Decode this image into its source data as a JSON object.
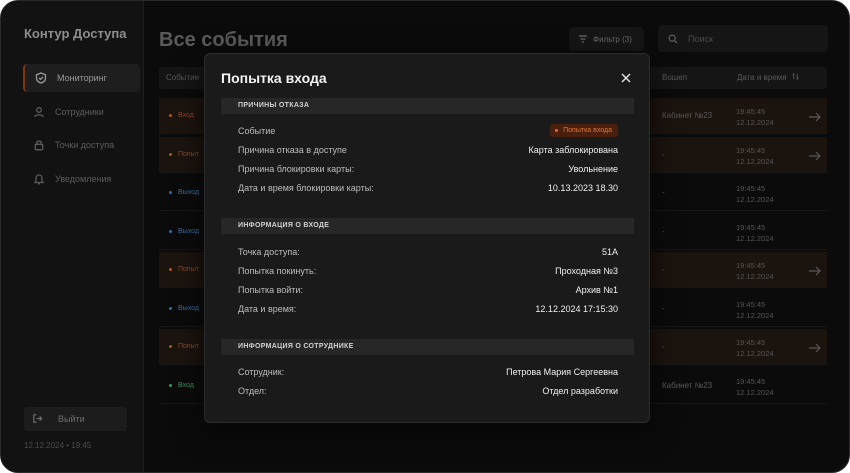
{
  "app": {
    "brand": "Контур Доступа",
    "datetime": "12.12.2024 • 19:45"
  },
  "sidebar": {
    "items": [
      {
        "label": "Мониторинг",
        "icon": "shield-icon",
        "active": true
      },
      {
        "label": "Сотрудники",
        "icon": "users-icon",
        "active": false
      },
      {
        "label": "Точки доступа",
        "icon": "lock-icon",
        "active": false
      },
      {
        "label": "Уведомления",
        "icon": "bell-icon",
        "active": false
      }
    ],
    "logout_label": "Выйти"
  },
  "main": {
    "title": "Все события",
    "filter_label": "Фильтр (3)",
    "search_placeholder": "Поиск",
    "columns": {
      "event": "Событие",
      "entered": "Вошел",
      "datetime": "Дата и время"
    },
    "rows": [
      {
        "event": "Вход",
        "kind": "warn",
        "room": "Кабинет №23",
        "time": "19:45:45",
        "date": "12.12.2024",
        "arrow": true
      },
      {
        "event": "Попыт",
        "kind": "warn",
        "room": "-",
        "time": "19:45:45",
        "date": "12.12.2024",
        "arrow": true
      },
      {
        "event": "Выход",
        "kind": "out",
        "room": "-",
        "time": "19:45:45",
        "date": "12.12.2024",
        "arrow": false
      },
      {
        "event": "Выход",
        "kind": "out",
        "room": "-",
        "time": "19:45:45",
        "date": "12.12.2024",
        "arrow": false
      },
      {
        "event": "Попыт",
        "kind": "warn",
        "room": "-",
        "time": "19:45:45",
        "date": "12.12.2024",
        "arrow": true
      },
      {
        "event": "Выход",
        "kind": "out",
        "room": "-",
        "time": "19:45:45",
        "date": "12.12.2024",
        "arrow": false
      },
      {
        "event": "Попыт",
        "kind": "warn",
        "room": "-",
        "time": "19:45:45",
        "date": "12.12.2024",
        "arrow": true
      },
      {
        "event": "Вход",
        "kind": "in",
        "room": "Кабинет №23",
        "time": "19:45:45",
        "date": "12.12.2024",
        "arrow": false
      }
    ]
  },
  "modal": {
    "title": "Попытка входа",
    "sections": {
      "reasons": {
        "title": "ПРИЧИНЫ ОТКАЗА",
        "event_label": "Событие",
        "event_badge": "Попытка входа",
        "reason_label": "Причина отказа в доступе",
        "reason_value": "Карта заблокирована",
        "block_reason_label": "Причина блокировки карты:",
        "block_reason_value": "Увольнение",
        "block_date_label": "Дата и время блокировки карты:",
        "block_date_value": "10.13.2023 18.30"
      },
      "entry": {
        "title": "ИНФОРМАЦИЯ О ВХОДЕ",
        "point_label": "Точка доступа:",
        "point_value": "51A",
        "leave_label": "Попытка покинуть:",
        "leave_value": "Проходная №3",
        "enter_label": "Попытка войти:",
        "enter_value": "Архив №1",
        "datetime_label": "Дата и время:",
        "datetime_value": "12.12.2024 17:15:30"
      },
      "employee": {
        "title": "ИНФОРМАЦИЯ О СОТРУДНИКЕ",
        "employee_label": "Сотрудник:",
        "employee_value": "Петрова Мария Сергеевна",
        "dept_label": "Отдел:",
        "dept_value": "Отдел разработки"
      }
    }
  },
  "colors": {
    "warn": "#b3531f",
    "out": "#2d6fb3",
    "in": "#2e9a5e",
    "accent": "#ee6a26"
  }
}
